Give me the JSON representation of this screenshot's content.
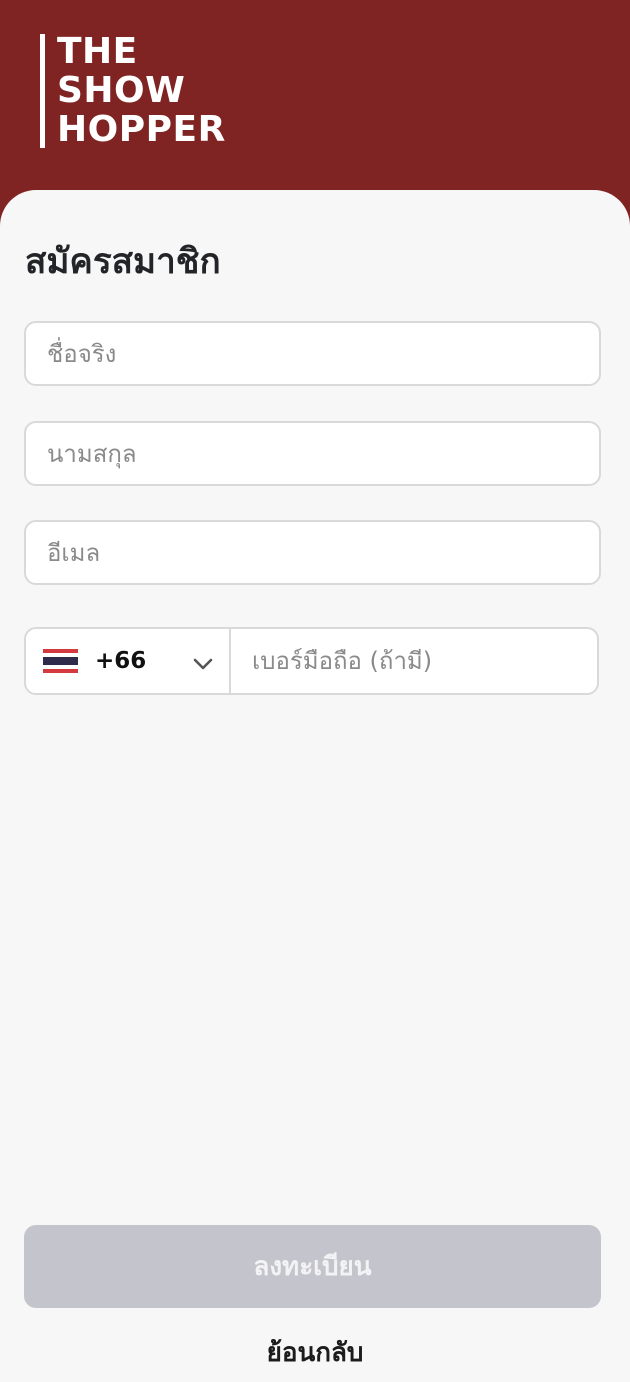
{
  "brand": {
    "logo_lines": [
      "THE",
      "SHOW",
      "HOPPER"
    ],
    "header_color": "#7f2422"
  },
  "form": {
    "title": "สมัครสมาชิก",
    "first_name_placeholder": "ชื่อจริง",
    "last_name_placeholder": "นามสกุล",
    "email_placeholder": "อีเมล",
    "phone": {
      "country_flag": "thailand-flag-icon",
      "dial_code": "+66",
      "placeholder": "เบอร์มือถือ (ถ้ามี)"
    }
  },
  "actions": {
    "register_label": "ลงทะเบียน",
    "back_label": "ย้อนกลับ",
    "register_disabled_color": "#c4c4cc"
  }
}
